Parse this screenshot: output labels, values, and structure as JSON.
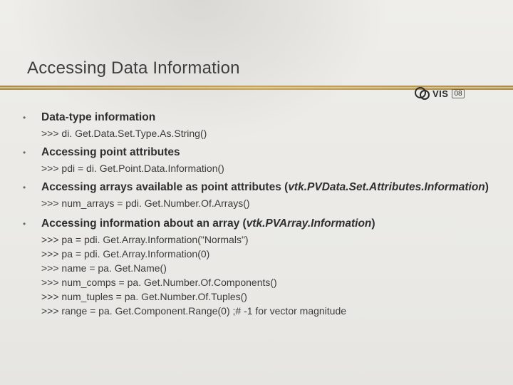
{
  "title": "Accessing Data Information",
  "logo": {
    "text": "VIS",
    "year": "08"
  },
  "sections": [
    {
      "heading_plain": "Data-type information",
      "heading_ital": "",
      "code": [
        ">>> di. Get.Data.Set.Type.As.String()"
      ]
    },
    {
      "heading_plain": "Accessing point attributes",
      "heading_ital": "",
      "code": [
        ">>> pdi = di. Get.Point.Data.Information()"
      ]
    },
    {
      "heading_plain": "Accessing arrays available as point attributes (",
      "heading_ital": "vtk.PVData.Set.Attributes.Information",
      "heading_tail": ")",
      "code": [
        ">>> num_arrays = pdi. Get.Number.Of.Arrays()"
      ]
    },
    {
      "heading_plain": "Accessing information about an array (",
      "heading_ital": "vtk.PVArray.Information",
      "heading_tail": ")",
      "code": [
        ">>> pa = pdi. Get.Array.Information(\"Normals\")",
        ">>> pa = pdi. Get.Array.Information(0)",
        ">>> name = pa. Get.Name()",
        ">>> num_comps = pa. Get.Number.Of.Components()",
        ">>> num_tuples = pa. Get.Number.Of.Tuples()",
        ">>> range = pa. Get.Component.Range(0) ;# -1 for vector magnitude"
      ]
    }
  ]
}
